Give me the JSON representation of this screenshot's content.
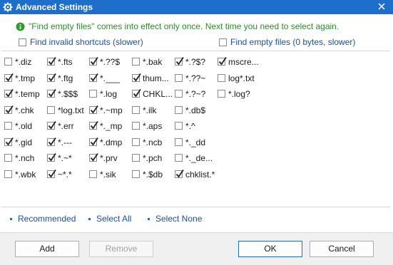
{
  "window": {
    "title": "Advanced Settings",
    "title_icon": "gear-icon",
    "close_icon": "close-icon",
    "accent_color": "#1e6fc9"
  },
  "info": {
    "icon": "info-icon",
    "text": "\"Find empty files\" comes into effect only once. Next time you need to select again.",
    "color": "#2e8b2e"
  },
  "options": [
    {
      "label": "Find invalid shortcuts (slower)",
      "checked": false
    },
    {
      "label": "Find empty files (0 bytes, slower)",
      "checked": false
    }
  ],
  "columns": [
    [
      {
        "label": "*.diz",
        "checked": false
      },
      {
        "label": "*.tmp",
        "checked": true
      },
      {
        "label": "*.temp",
        "checked": true
      },
      {
        "label": "*.chk",
        "checked": true
      },
      {
        "label": "*.old",
        "checked": false
      },
      {
        "label": "*.gid",
        "checked": true
      },
      {
        "label": "*.nch",
        "checked": false
      },
      {
        "label": "*.wbk",
        "checked": false
      }
    ],
    [
      {
        "label": "*.fts",
        "checked": true
      },
      {
        "label": "*.ftg",
        "checked": true
      },
      {
        "label": "*.$$$",
        "checked": true
      },
      {
        "label": "*log.txt",
        "checked": false
      },
      {
        "label": "*.err",
        "checked": true
      },
      {
        "label": "*.---",
        "checked": true
      },
      {
        "label": "*.~*",
        "checked": true
      },
      {
        "label": "~*.*",
        "checked": true
      }
    ],
    [
      {
        "label": "*.??$",
        "checked": true
      },
      {
        "label": "*.___",
        "checked": true
      },
      {
        "label": "*.log",
        "checked": false
      },
      {
        "label": "*.~mp",
        "checked": true
      },
      {
        "label": "*._mp",
        "checked": true
      },
      {
        "label": "*.dmp",
        "checked": true
      },
      {
        "label": "*.prv",
        "checked": true
      },
      {
        "label": "*.sik",
        "checked": false
      }
    ],
    [
      {
        "label": "*.bak",
        "checked": false
      },
      {
        "label": "thum...",
        "checked": true
      },
      {
        "label": "CHKL...",
        "checked": true
      },
      {
        "label": "*.ilk",
        "checked": false
      },
      {
        "label": "*.aps",
        "checked": false
      },
      {
        "label": "*.ncb",
        "checked": false
      },
      {
        "label": "*.pch",
        "checked": false
      },
      {
        "label": "*.$db",
        "checked": false
      }
    ],
    [
      {
        "label": "*.?$?",
        "checked": true
      },
      {
        "label": "*.??~",
        "checked": false
      },
      {
        "label": "*.?~?",
        "checked": false
      },
      {
        "label": "*.db$",
        "checked": false
      },
      {
        "label": "*.^",
        "checked": false
      },
      {
        "label": "*._dd",
        "checked": false
      },
      {
        "label": "*._de...",
        "checked": false
      },
      {
        "label": "chklist.*",
        "checked": true
      }
    ],
    [
      {
        "label": "mscre...",
        "checked": true
      },
      {
        "label": "log*.txt",
        "checked": false
      },
      {
        "label": "*.log?",
        "checked": false
      }
    ]
  ],
  "links": {
    "recommended": "Recommended",
    "select_all": "Select All",
    "select_none": "Select None"
  },
  "buttons": {
    "add": "Add",
    "remove": "Remove",
    "ok": "OK",
    "cancel": "Cancel"
  }
}
